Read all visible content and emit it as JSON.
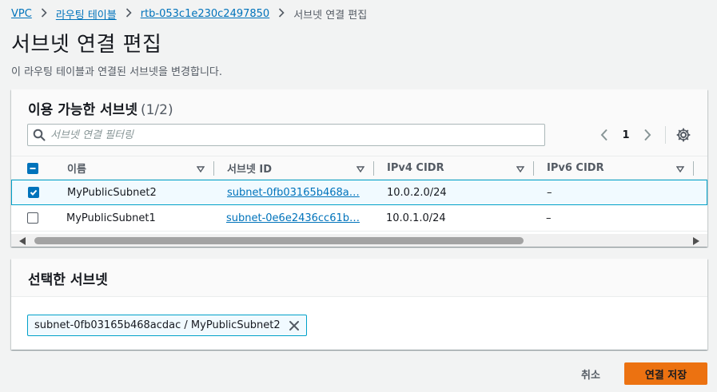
{
  "breadcrumb": {
    "items": [
      "VPC",
      "라우팅 테이블",
      "rtb-053c1e230c2497850"
    ],
    "current": "서브넷 연결 편집"
  },
  "page": {
    "title": "서브넷 연결 편집",
    "description": "이 라우팅 테이블과 연결된 서브넷을 변경합니다."
  },
  "available": {
    "title": "이용 가능한 서브넷",
    "count": "(1/2)",
    "filter_placeholder": "서브넷 연결 필터링",
    "page_number": "1",
    "columns": [
      "이름",
      "서브넷 ID",
      "IPv4 CIDR",
      "IPv6 CIDR"
    ],
    "rows": [
      {
        "name": "MyPublicSubnet2",
        "subnet_id": "subnet-0fb03165b468a…",
        "ipv4": "10.0.2.0/24",
        "ipv6": "–",
        "selected": true
      },
      {
        "name": "MyPublicSubnet1",
        "subnet_id": "subnet-0e6e2436cc61b…",
        "ipv4": "10.0.1.0/24",
        "ipv6": "–",
        "selected": false
      }
    ]
  },
  "selected_panel": {
    "title": "선택한 서브넷",
    "token": "subnet-0fb03165b468acdac / MyPublicSubnet2"
  },
  "actions": {
    "cancel": "취소",
    "save": "연결 저장"
  },
  "colors": {
    "link": "#0073bb",
    "primary_button": "#ec7211",
    "selected_border": "#00a1c9"
  }
}
